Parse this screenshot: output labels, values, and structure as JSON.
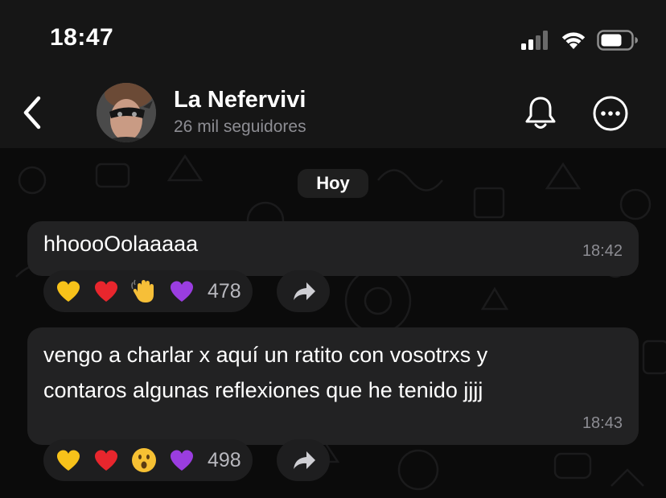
{
  "status_bar": {
    "time": "18:47"
  },
  "header": {
    "back_icon": "chevron-left-icon",
    "title": "La Nefervivi",
    "subtitle": "26 mil seguidores",
    "bell_icon": "bell-icon",
    "more_icon": "ellipsis-circle-icon"
  },
  "chat": {
    "day_label": "Hoy",
    "messages": [
      {
        "text": "hhoooOolaaaaa",
        "time": "18:42",
        "reactions": [
          "yellow-heart",
          "red-heart",
          "waving-hand",
          "purple-heart"
        ],
        "reaction_count": "478"
      },
      {
        "text_line1": "vengo a charlar x aquí un ratito con vosotrxs y",
        "text_line2": "contaros algunas reflexiones que he tenido jjjj",
        "time": "18:43",
        "reactions": [
          "yellow-heart",
          "red-heart",
          "astonished-face",
          "purple-heart"
        ],
        "reaction_count": "498"
      }
    ]
  },
  "colors": {
    "bubble": "#222223",
    "background": "#0b0b0b",
    "header": "#161616",
    "secondary_text": "#8d8d93"
  }
}
